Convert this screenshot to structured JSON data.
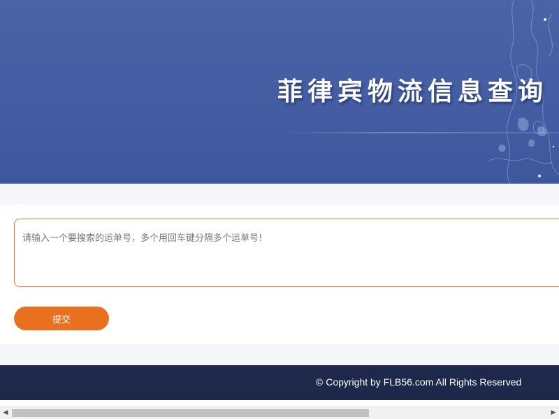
{
  "banner": {
    "title": "菲律宾物流信息查询"
  },
  "tracking_form": {
    "placeholder": "请输入一个要搜索的运单号，多个用回车键分隔多个运单号!",
    "value": "",
    "submit_label": "提交"
  },
  "footer": {
    "copyright": "© Copyright by FLB56.com All Rights Reserved"
  },
  "scrollbar": {
    "left_arrow_icon": "◀",
    "right_arrow_icon": "▶"
  },
  "colors": {
    "banner_blue": "#4a63a6",
    "accent_orange": "#e8701f",
    "input_border": "#e0783a",
    "footer_navy": "#1e284a"
  }
}
